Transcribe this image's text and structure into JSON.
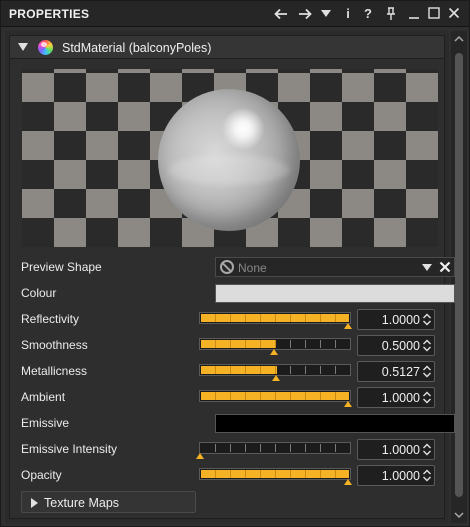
{
  "panel": {
    "title": "PROPERTIES",
    "toolbar_icons": [
      "back-arrow-icon",
      "forward-arrow-icon",
      "dropdown-icon",
      "info-icon",
      "help-icon",
      "pin-icon",
      "minimize-icon",
      "maximize-icon",
      "close-icon"
    ],
    "toolbar_glyphs": {
      "info": "i",
      "help": "?"
    }
  },
  "section": {
    "title": "StdMaterial (balconyPoles)",
    "expanded": true
  },
  "preview_shape": {
    "label": "Preview Shape",
    "value": "None"
  },
  "colour": {
    "label": "Colour",
    "swatch": "#dcdcdc"
  },
  "reflectivity": {
    "label": "Reflectivity",
    "value_text": "1.0000",
    "fraction": 1.0
  },
  "smoothness": {
    "label": "Smoothness",
    "value_text": "0.5000",
    "fraction": 0.5
  },
  "metallicness": {
    "label": "Metallicness",
    "value_text": "0.5127",
    "fraction": 0.5127
  },
  "ambient": {
    "label": "Ambient",
    "value_text": "1.0000",
    "fraction": 1.0
  },
  "emissive": {
    "label": "Emissive",
    "swatch": "#000000"
  },
  "emissive_intensity": {
    "label": "Emissive Intensity",
    "value_text": "1.0000",
    "fraction": 0.0
  },
  "opacity": {
    "label": "Opacity",
    "value_text": "1.0000",
    "fraction": 1.0
  },
  "texture_maps": {
    "label": "Texture Maps",
    "expanded": false
  },
  "colors": {
    "accent": "#f5b225",
    "panel_bg": "#2f2f2f"
  }
}
